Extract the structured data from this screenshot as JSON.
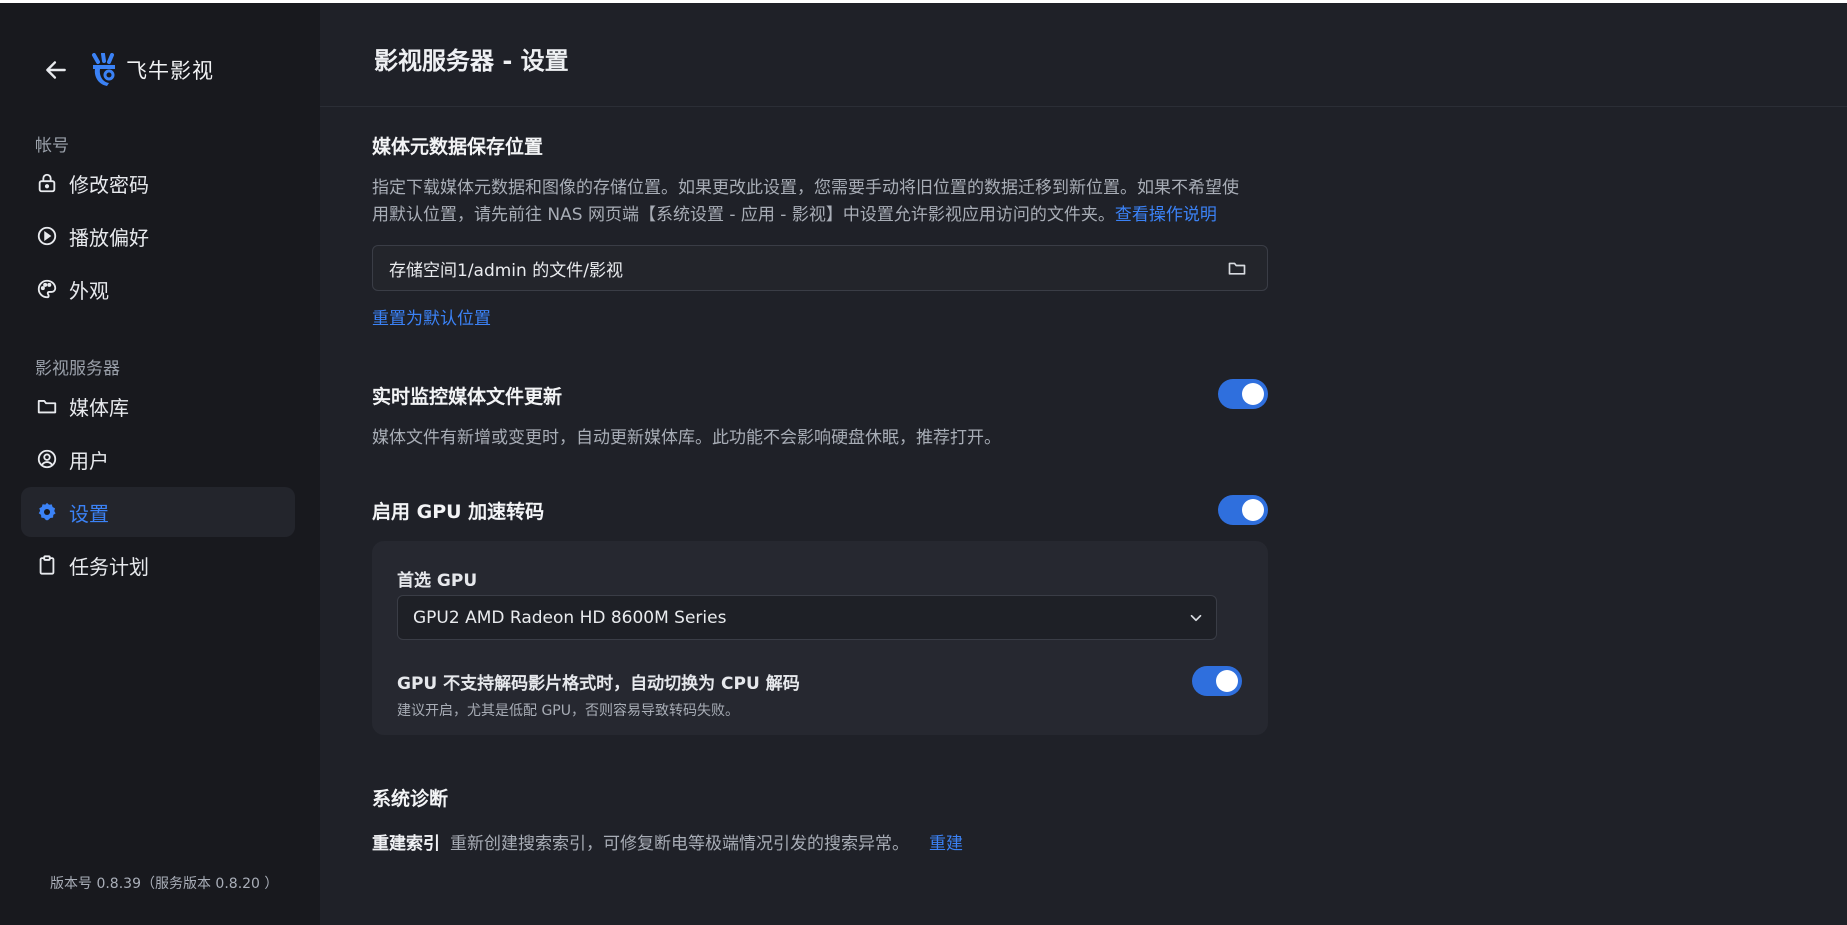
{
  "sidebar": {
    "brand_name": "飞牛影视",
    "sections": [
      {
        "label": "帐号"
      },
      {
        "label": "影视服务器"
      }
    ],
    "items": [
      {
        "label": "修改密码",
        "icon": "lock-icon"
      },
      {
        "label": "播放偏好",
        "icon": "play-circle-icon"
      },
      {
        "label": "外观",
        "icon": "palette-icon"
      },
      {
        "label": "媒体库",
        "icon": "folder-icon"
      },
      {
        "label": "用户",
        "icon": "user-circle-icon"
      },
      {
        "label": "设置",
        "icon": "gear-icon",
        "active": true
      },
      {
        "label": "任务计划",
        "icon": "clipboard-icon"
      }
    ],
    "version": "版本号 0.8.39（服务版本 0.8.20 ）"
  },
  "header": {
    "title": "影视服务器 - 设置"
  },
  "metadata_location": {
    "title": "媒体元数据保存位置",
    "desc_line1": "指定下载媒体元数据和图像的存储位置。如果更改此设置，您需要手动将旧位置的数据迁移到新位置。如果不希望使",
    "desc_line2": "用默认位置，请先前往 NAS 网页端【系统设置 - 应用 - 影视】中设置允许影视应用访问的文件夹。",
    "help_link": "查看操作说明",
    "path_value": "存储空间1/admin 的文件/影视",
    "reset_link": "重置为默认位置"
  },
  "realtime_monitor": {
    "title": "实时监控媒体文件更新",
    "desc": "媒体文件有新增或变更时，自动更新媒体库。此功能不会影响硬盘休眠，推荐打开。",
    "enabled": true
  },
  "gpu": {
    "title": "启用 GPU 加速转码",
    "enabled": true,
    "preferred_label": "首选 GPU",
    "selected": "GPU2 AMD Radeon HD 8600M Series",
    "fallback_title": "GPU 不支持解码影片格式时，自动切换为 CPU 解码",
    "fallback_desc": "建议开启，尤其是低配 GPU，否则容易导致转码失败。",
    "fallback_enabled": true
  },
  "diagnostics": {
    "title": "系统诊断",
    "rebuild_label": "重建索引",
    "rebuild_desc": "重新创建搜索索引，可修复断电等极端情况引发的搜索异常。",
    "rebuild_link": "重建"
  },
  "colors": {
    "accent": "#3b82f6",
    "toggle_on": "#2f6fdd",
    "sidebar_bg": "#18191e",
    "main_bg": "#1f2128"
  }
}
